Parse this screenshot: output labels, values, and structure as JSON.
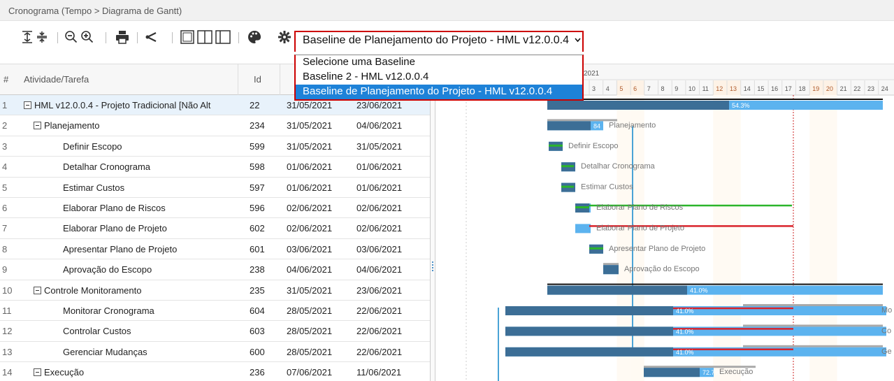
{
  "breadcrumb": "Cronograma  (Tempo > Diagrama de Gantt)",
  "baseline": {
    "selected": "Baseline de Planejamento do Projeto - HML v12.0.0.4",
    "options": [
      "Selecione uma Baseline",
      "Baseline 2 - HML v12.0.0.4",
      "Baseline de Planejamento do Projeto - HML v12.0.0.4"
    ]
  },
  "columns": {
    "num": "#",
    "task": "Atividade/Tarefa",
    "id": "Id"
  },
  "timeline": {
    "year": "2021",
    "days": [
      "3",
      "4",
      "5",
      "6",
      "7",
      "8",
      "9",
      "10",
      "11",
      "12",
      "13",
      "14",
      "15",
      "16",
      "17",
      "18",
      "19",
      "20",
      "21",
      "22",
      "23",
      "24"
    ],
    "weekend_days": [
      "5",
      "6",
      "12",
      "13",
      "19",
      "20"
    ]
  },
  "rows": [
    {
      "num": "1",
      "name": "HML v12.0.0.4 - Projeto Tradicional [Não Alt",
      "id": "22",
      "start": "31/05/2021",
      "end": "23/06/2021",
      "tree": true,
      "indent": 0
    },
    {
      "num": "2",
      "name": "Planejamento",
      "id": "234",
      "start": "31/05/2021",
      "end": "04/06/2021",
      "tree": true,
      "indent": 1
    },
    {
      "num": "3",
      "name": "Definir Escopo",
      "id": "599",
      "start": "31/05/2021",
      "end": "31/05/2021",
      "tree": false,
      "indent": 2
    },
    {
      "num": "4",
      "name": "Detalhar Cronograma",
      "id": "598",
      "start": "01/06/2021",
      "end": "01/06/2021",
      "tree": false,
      "indent": 2
    },
    {
      "num": "5",
      "name": "Estimar Custos",
      "id": "597",
      "start": "01/06/2021",
      "end": "01/06/2021",
      "tree": false,
      "indent": 2
    },
    {
      "num": "6",
      "name": "Elaborar Plano de Riscos",
      "id": "596",
      "start": "02/06/2021",
      "end": "02/06/2021",
      "tree": false,
      "indent": 2
    },
    {
      "num": "7",
      "name": "Elaborar Plano de Projeto",
      "id": "602",
      "start": "02/06/2021",
      "end": "02/06/2021",
      "tree": false,
      "indent": 2
    },
    {
      "num": "8",
      "name": "Apresentar Plano de Projeto",
      "id": "601",
      "start": "03/06/2021",
      "end": "03/06/2021",
      "tree": false,
      "indent": 2
    },
    {
      "num": "9",
      "name": "Aprovação do Escopo",
      "id": "238",
      "start": "04/06/2021",
      "end": "04/06/2021",
      "tree": false,
      "indent": 2
    },
    {
      "num": "10",
      "name": "Controle Monitoramento",
      "id": "235",
      "start": "31/05/2021",
      "end": "23/06/2021",
      "tree": true,
      "indent": 1
    },
    {
      "num": "11",
      "name": "Monitorar Cronograma",
      "id": "604",
      "start": "28/05/2021",
      "end": "22/06/2021",
      "tree": false,
      "indent": 2
    },
    {
      "num": "12",
      "name": "Controlar Custos",
      "id": "603",
      "start": "28/05/2021",
      "end": "22/06/2021",
      "tree": false,
      "indent": 2
    },
    {
      "num": "13",
      "name": "Gerenciar Mudanças",
      "id": "600",
      "start": "28/05/2021",
      "end": "22/06/2021",
      "tree": false,
      "indent": 2
    },
    {
      "num": "14",
      "name": "Execução",
      "id": "236",
      "start": "07/06/2021",
      "end": "11/06/2021",
      "tree": true,
      "indent": 1
    }
  ],
  "bars": [
    {
      "row": 0,
      "label": "54.3%",
      "side": ""
    },
    {
      "row": 1,
      "label": "84",
      "side": "Planejamento"
    },
    {
      "row": 2,
      "label": "",
      "side": "Definir Escopo"
    },
    {
      "row": 3,
      "label": "",
      "side": "Detalhar Cronograma"
    },
    {
      "row": 4,
      "label": "",
      "side": "Estimar Custos"
    },
    {
      "row": 5,
      "label": "",
      "side": "Elaborar Plano de Riscos"
    },
    {
      "row": 6,
      "label": "",
      "side": "Elaborar Plano de Projeto"
    },
    {
      "row": 7,
      "label": "",
      "side": "Apresentar Plano de Projeto"
    },
    {
      "row": 8,
      "label": "",
      "side": "Aprovação do Escopo"
    },
    {
      "row": 9,
      "label": "41.0%",
      "side": ""
    },
    {
      "row": 10,
      "label": "41.0%",
      "side": "Mo"
    },
    {
      "row": 11,
      "label": "41.0%",
      "side": "Co"
    },
    {
      "row": 12,
      "label": "41.0%",
      "side": "Ge"
    },
    {
      "row": 13,
      "label": "72.7%",
      "side": "Execução"
    }
  ],
  "colors": {
    "bar_dark": "#3c6e96",
    "bar_light": "#5cb3ef",
    "line_green": "#2bb52b",
    "line_red": "#d9232b",
    "baseline_gray": "#a9a9a9",
    "select_blue": "#1e82d8",
    "weekend": "#fdf2e6"
  }
}
